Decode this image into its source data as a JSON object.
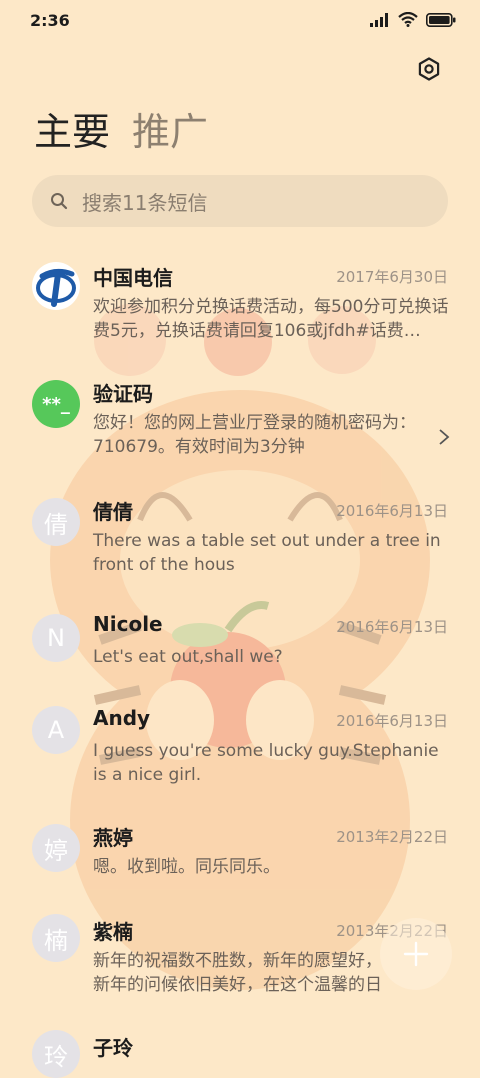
{
  "status_bar": {
    "time": "2:36"
  },
  "tabs": [
    {
      "label": "主要",
      "active": true
    },
    {
      "label": "推广",
      "active": false
    }
  ],
  "search": {
    "placeholder": "搜索11条短信"
  },
  "messages": [
    {
      "name": "中国电信",
      "date": "2017年6月30日",
      "preview": "欢迎参加积分兑换话费活动，每500分可兑换话费5元，兑换话费请回复106或jfdh#话费…",
      "avatar": "china-telecom-logo"
    },
    {
      "name": "验证码",
      "date": "",
      "preview": "您好！您的网上营业厅登录的随机密码为：710679。有效时间为3分钟",
      "avatar_text": "**_",
      "avatar_color": "#56c85a"
    },
    {
      "name": "倩倩",
      "date": "2016年6月13日",
      "preview": "There was a table set out under a tree in front of the hous",
      "avatar_text": "倩"
    },
    {
      "name": "Nicole",
      "date": "2016年6月13日",
      "preview": "Let's eat out,shall we?",
      "avatar_text": "N"
    },
    {
      "name": "Andy",
      "date": "2016年6月13日",
      "preview": "I guess you're some lucky guy.Stephanie is a nice girl.",
      "avatar_text": "A"
    },
    {
      "name": "燕婷",
      "date": "2013年2月22日",
      "preview": "嗯。收到啦。同乐同乐。",
      "avatar_text": "婷"
    },
    {
      "name": "紫楠",
      "date": "2013年2月22日",
      "preview": "新年的祝福数不胜数，新年的愿望好，新年的问候依旧美好，在这个温馨的日",
      "avatar_text": "楠"
    },
    {
      "name": "子玲",
      "date": "",
      "preview": "",
      "avatar_text": "玲"
    }
  ],
  "colors": {
    "background": "#fde8c8",
    "accent_green": "#56c85a",
    "telecom_blue": "#1e5aa8"
  }
}
